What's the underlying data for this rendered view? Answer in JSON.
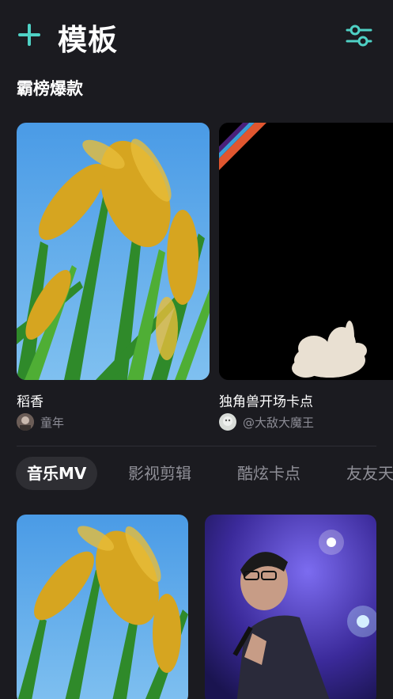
{
  "header": {
    "title": "模板",
    "add_icon": "plus-icon",
    "settings_icon": "sliders-icon",
    "accent_color": "#4fd1c5"
  },
  "section": {
    "title": "霸榜爆款"
  },
  "featured": [
    {
      "title": "稻香",
      "author": "童年",
      "thumb": "rice-field-image"
    },
    {
      "title": "独角兽开场卡点",
      "author": "@大敌大魔王",
      "thumb": "unicorn-opening-image"
    }
  ],
  "tabs": [
    {
      "label": "音乐MV",
      "active": true
    },
    {
      "label": "影视剪辑",
      "active": false
    },
    {
      "label": "酷炫卡点",
      "active": false
    },
    {
      "label": "友友天",
      "active": false
    }
  ],
  "grid": [
    {
      "thumb": "rice-field-image"
    },
    {
      "thumb": "concert-singer-image"
    }
  ]
}
